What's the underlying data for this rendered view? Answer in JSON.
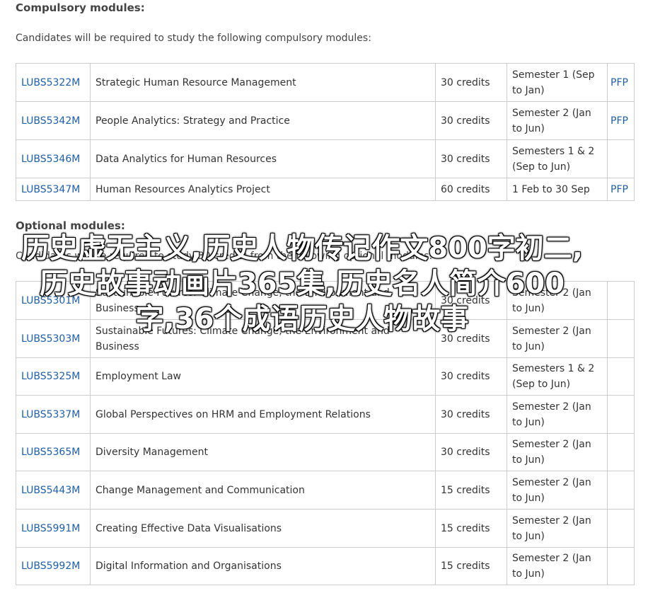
{
  "compulsory": {
    "heading": "Compulsory modules:",
    "intro": "Candidates will be required to study the following compulsory modules:",
    "rows": [
      {
        "code": "LUBS5322M",
        "title": "Strategic Human Resource Management",
        "credits": "30 credits",
        "semester": "Semester 1 (Sep to Jan)",
        "pfp": "PFP"
      },
      {
        "code": "LUBS5342M",
        "title": "People Analytics: Strategy and Practice",
        "credits": "30 credits",
        "semester": "Semester 2 (Jan to Jun)",
        "pfp": "PFP"
      },
      {
        "code": "LUBS5346M",
        "title": "Data Analytics for Human Resources",
        "credits": "30 credits",
        "semester": "Semesters 1 & 2 (Sep to Jun)",
        "pfp": ""
      },
      {
        "code": "LUBS5347M",
        "title": "Human Resources Analytics Project",
        "credits": "60 credits",
        "semester": "1 Feb to 30 Sep",
        "pfp": "PFP"
      }
    ]
  },
  "optional": {
    "heading": "Optional modules:",
    "intro": "Candidates will be required to study 30 credits from the following optional modules:",
    "rows": [
      {
        "code": "LUBS5301M",
        "title": "Sustainable Futures: Climate Change, the Environment and Business",
        "credits": "30 credits",
        "semester": "Semester 2 (Jan to Jun)",
        "pfp": ""
      },
      {
        "code": "LUBS5303M",
        "title": "Sustainable Futures: Climate Change, the Environment and Business",
        "credits": "30 credits",
        "semester": "Semester 2 (Jan to Jun)",
        "pfp": ""
      },
      {
        "code": "LUBS5325M",
        "title": "Employment Law",
        "credits": "30 credits",
        "semester": "Semesters 1 & 2 (Sep to Jun)",
        "pfp": ""
      },
      {
        "code": "LUBS5337M",
        "title": "Global Perspectives on HRM and Employment Relations",
        "credits": "30 credits",
        "semester": "Semester 2 (Jan to Jun)",
        "pfp": ""
      },
      {
        "code": "LUBS5365M",
        "title": "Diversity Management",
        "credits": "30 credits",
        "semester": "Semester 2 (Jan to Jun)",
        "pfp": ""
      },
      {
        "code": "LUBS5443M",
        "title": "Change Management and Communication",
        "credits": "15 credits",
        "semester": "Semester 2 (Jan to Jun)",
        "pfp": ""
      },
      {
        "code": "LUBS5991M",
        "title": "Creating Effective Data Visualisations",
        "credits": "15 credits",
        "semester": "Semester 2 (Jan to Jun)",
        "pfp": ""
      },
      {
        "code": "LUBS5992M",
        "title": "Digital Information and Organisations",
        "credits": "15 credits",
        "semester": "Semester 2 (Jan to Jun)",
        "pfp": ""
      }
    ]
  },
  "overlay_text": "历史虚无主义,历史人物传记作文800字初二,历史故事动画片365集,历史名人简介600字,36个成语历史人物故事"
}
